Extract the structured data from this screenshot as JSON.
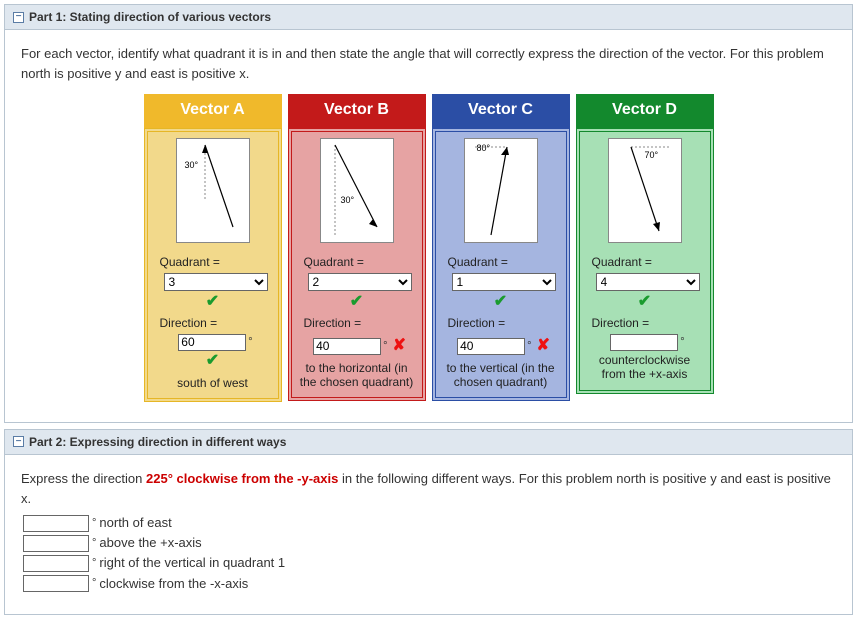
{
  "part1": {
    "header": "Part 1: Stating direction of various vectors",
    "instructions": "For each vector, identify what quadrant it is in and then state the angle that will correctly express the direction of the vector. For this problem north is positive y and east is positive x.",
    "quadrant_label": "Quadrant =",
    "direction_label": "Direction =",
    "vectors": {
      "A": {
        "title": "Vector A",
        "angle_label": "30°",
        "quadrant_value": "3",
        "quadrant_status": "correct",
        "direction_value": "60",
        "direction_status": "correct",
        "description": "south of west"
      },
      "B": {
        "title": "Vector B",
        "angle_label": "30°",
        "quadrant_value": "2",
        "quadrant_status": "correct",
        "direction_value": "40",
        "direction_status": "wrong",
        "description": "to the horizontal (in the chosen quadrant)"
      },
      "C": {
        "title": "Vector C",
        "angle_label": "80°",
        "quadrant_value": "1",
        "quadrant_status": "correct",
        "direction_value": "40",
        "direction_status": "wrong",
        "description": "to the vertical (in the chosen quadrant)"
      },
      "D": {
        "title": "Vector D",
        "angle_label": "70°",
        "quadrant_value": "4",
        "quadrant_status": "correct",
        "direction_value": "",
        "direction_status": "",
        "description": "counterclockwise from the +x-axis"
      }
    }
  },
  "part2": {
    "header": "Part 2: Expressing direction in different ways",
    "prefix": "Express the direction ",
    "highlight": "225° clockwise from the -y-axis",
    "suffix": " in the following different ways. For this problem north is positive y and east is positive x.",
    "rows": [
      {
        "value": "",
        "label": "north of east"
      },
      {
        "value": "",
        "label": "above the +x-axis"
      },
      {
        "value": "",
        "label": "right of the vertical in quadrant 1"
      },
      {
        "value": "",
        "label": "clockwise from the -x-axis"
      }
    ]
  },
  "deg_symbol": "°"
}
